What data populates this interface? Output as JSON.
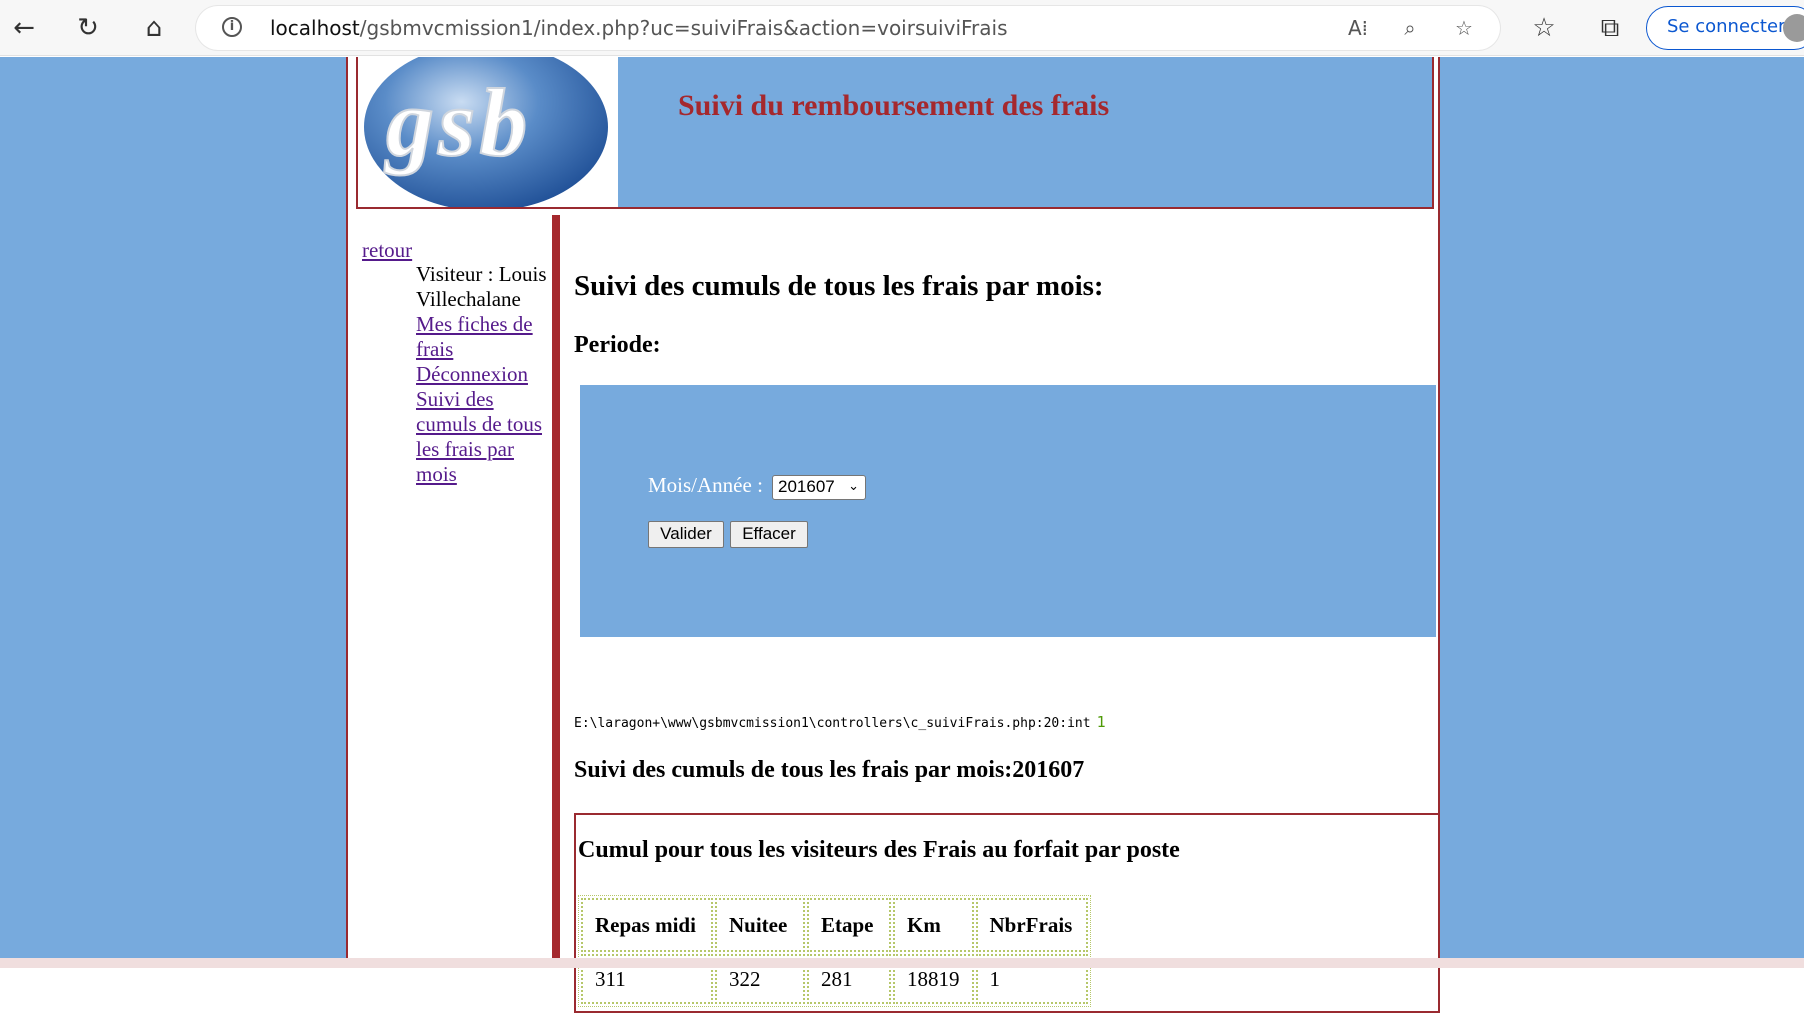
{
  "browser": {
    "url_host": "localhost",
    "url_path": "/gsbmvcmission1/index.php?uc=suiviFrais&action=voirsuiviFrais",
    "signin_label": "Se connecter"
  },
  "header": {
    "logo_text": "gsb",
    "title": "Suivi du remboursement des frais"
  },
  "sidebar": {
    "retour_label": "retour",
    "visitor_text": "Visiteur : Louis Villechalane",
    "items": [
      {
        "label": "Mes fiches de frais"
      },
      {
        "label": "Déconnexion"
      },
      {
        "label": "Suivi des cumuls de tous les frais par mois"
      }
    ]
  },
  "main": {
    "heading": "Suivi des cumuls de tous les frais par mois:",
    "periode_label": "Periode:",
    "form": {
      "mois_label": "Mois/Année :",
      "mois_selected": "201607",
      "valider_label": "Valider",
      "effacer_label": "Effacer"
    },
    "debug_path": "E:\\laragon+\\www\\gsbmvcmission1\\controllers\\c_suiviFrais.php:20:int",
    "debug_value": "1",
    "result_heading": "Suivi des cumuls de tous les frais par mois:201607",
    "table_heading": "Cumul pour tous les visiteurs des Frais au forfait par poste",
    "table": {
      "headers": [
        "Repas midi",
        "Nuitee",
        "Etape",
        "Km",
        "NbrFrais"
      ],
      "rows": [
        [
          "311",
          "322",
          "281",
          "18819",
          "1"
        ]
      ]
    }
  },
  "colors": {
    "page_background": "#77aadd",
    "accent_red": "#a5282d",
    "link": "#551a8b"
  }
}
